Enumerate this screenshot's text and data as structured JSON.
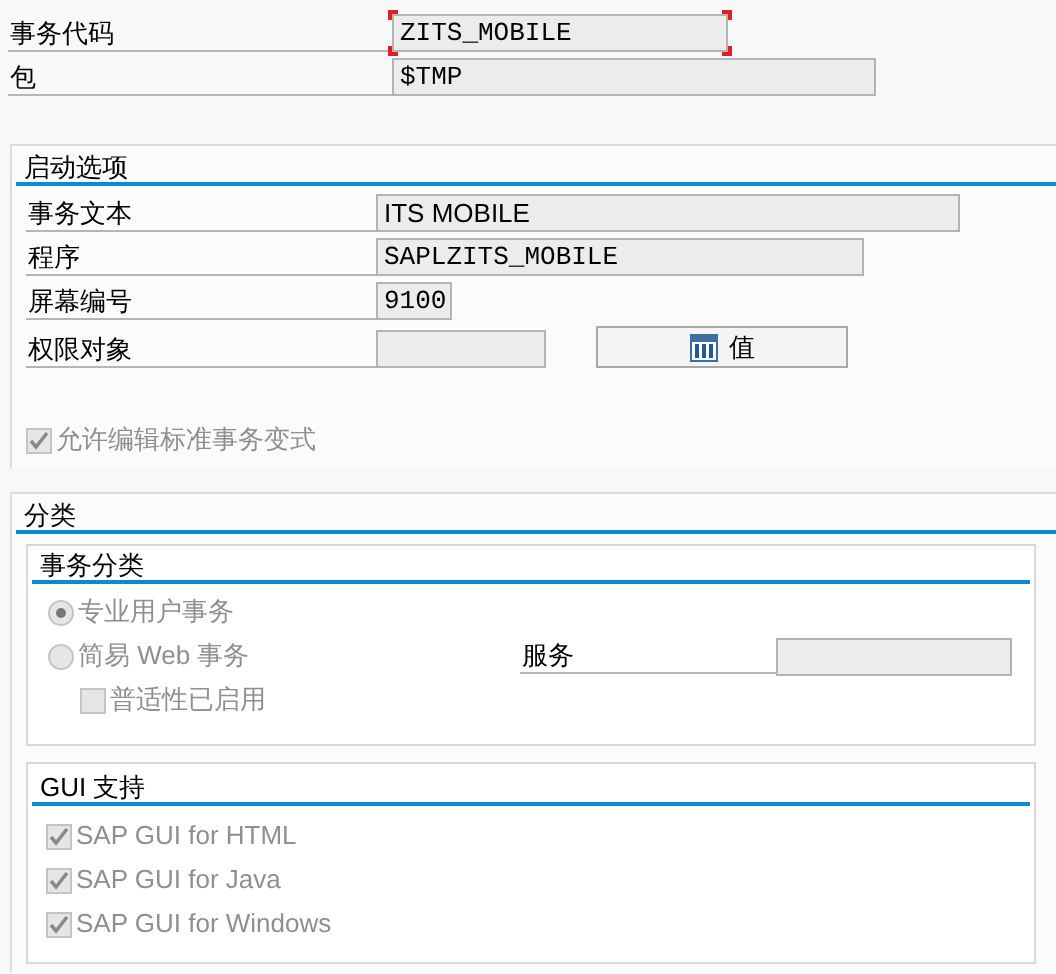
{
  "header_fields": [
    {
      "label": "事务代码",
      "value": "ZITS_MOBILE",
      "focused": true
    },
    {
      "label": "包",
      "value": "$TMP",
      "focused": false
    }
  ],
  "start_options": {
    "title": "启动选项",
    "fields": [
      {
        "label": "事务文本",
        "value": "ITS MOBILE"
      },
      {
        "label": "程序",
        "value": "SAPLZITS_MOBILE"
      },
      {
        "label": "屏幕编号",
        "value": "9100"
      }
    ],
    "authorization": {
      "label": "权限对象"
    },
    "values_button": "值",
    "allow_variants": {
      "label": "允许编辑标准事务变式",
      "checked": true,
      "disabled": true
    }
  },
  "classification": {
    "title": "分类",
    "transaction_type": {
      "title": "事务分类",
      "options": [
        {
          "label": "专业用户事务",
          "selected": true,
          "disabled": true
        },
        {
          "label": "简易 Web 事务",
          "selected": false,
          "disabled": true
        }
      ],
      "pervasive": {
        "label": "普适性已启用",
        "checked": false,
        "disabled": true
      },
      "service": {
        "label": "服务"
      }
    },
    "gui_support": {
      "title": "GUI 支持",
      "items": [
        {
          "label": "SAP GUI for HTML",
          "checked": true,
          "disabled": true
        },
        {
          "label": "SAP GUI for Java",
          "checked": true,
          "disabled": true
        },
        {
          "label": "SAP GUI for Windows",
          "checked": true,
          "disabled": true
        }
      ]
    }
  }
}
